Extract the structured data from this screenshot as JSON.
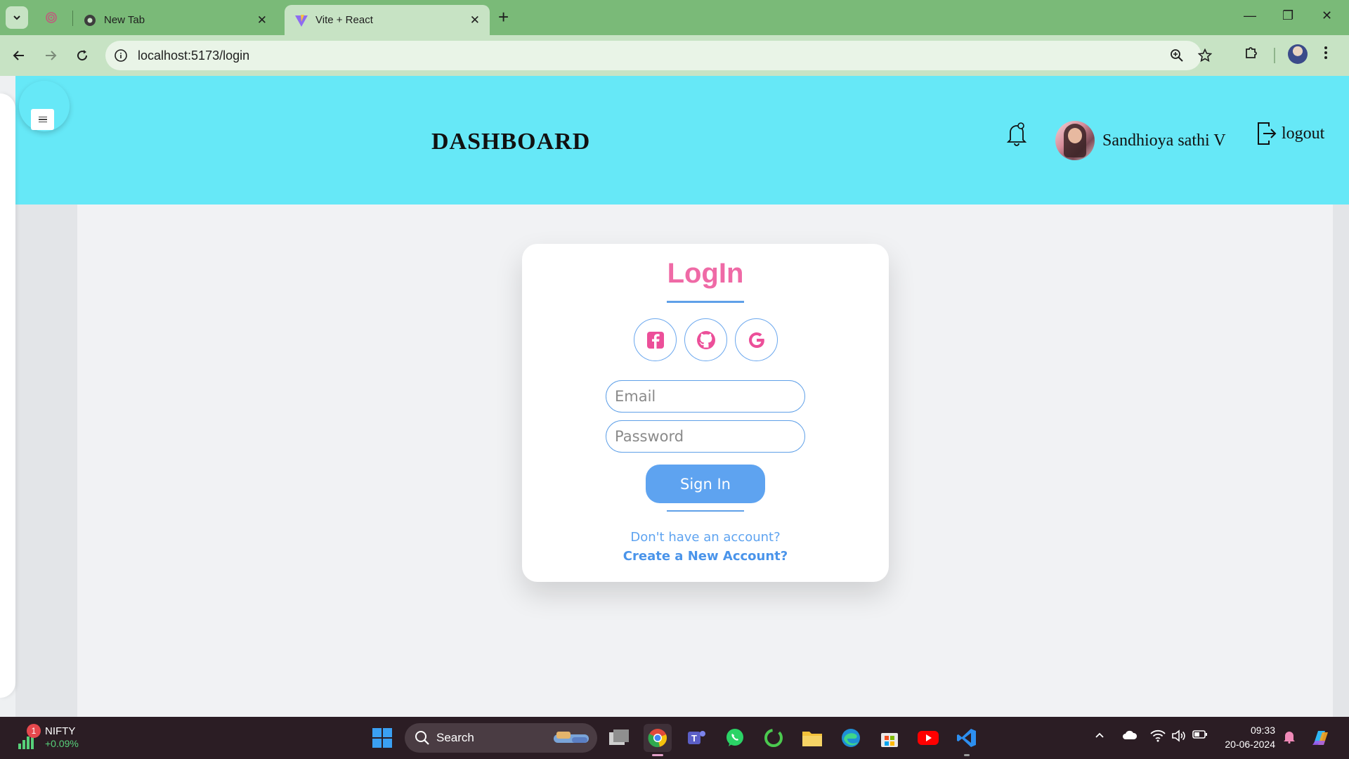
{
  "browser": {
    "tabs": [
      {
        "label": "New Tab"
      },
      {
        "label": "Vite + React"
      }
    ],
    "address": "localhost:5173/login"
  },
  "header": {
    "title": "DASHBOARD",
    "user_name": "Sandhioya sathi V",
    "logout_label": "logout"
  },
  "login": {
    "title": "LogIn",
    "email_placeholder": "Email",
    "password_placeholder": "Password",
    "signin_label": "Sign In",
    "no_account_text": "Don't have an account?",
    "create_account_link": "Create a New Account?",
    "social": [
      "facebook-icon",
      "github-icon",
      "google-icon"
    ]
  },
  "taskbar": {
    "ticker_name": "NIFTY",
    "ticker_change": "+0.09%",
    "ticker_badge": "1",
    "search_label": "Search",
    "time": "09:33",
    "date": "20-06-2024"
  },
  "colors": {
    "header_bg": "#66e8f7",
    "accent_pink": "#ef6aa6",
    "accent_blue": "#5ea3f0",
    "chrome_green": "#7aba78"
  }
}
